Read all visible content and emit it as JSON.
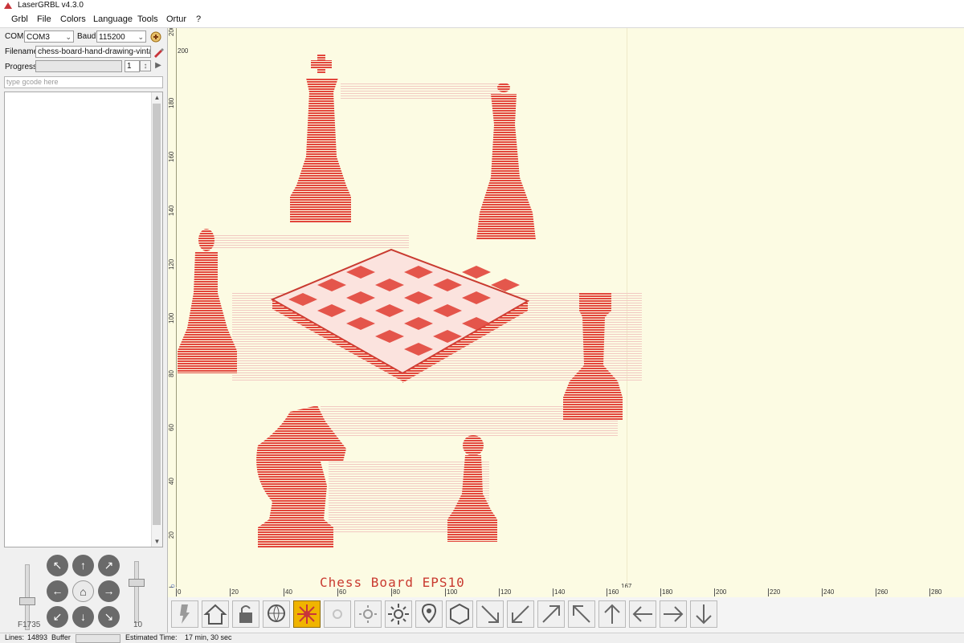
{
  "app": {
    "title": "LaserGRBL v4.3.0"
  },
  "menu": [
    "Grbl",
    "File",
    "Colors",
    "Language",
    "Tools",
    "Ortur",
    "?"
  ],
  "connection": {
    "com_label": "COM",
    "com_value": "COM3",
    "baud_label": "Baud",
    "baud_value": "115200",
    "filename_label": "Filename",
    "filename_value": "chess-board-hand-drawing-vintage-sty",
    "progress_label": "Progress",
    "progress_passes": "1"
  },
  "gcode": {
    "placeholder": "type gcode here"
  },
  "jog": {
    "feed_label": "F1735",
    "step_label": "10",
    "buttons": [
      "up-left",
      "up",
      "up-right",
      "left",
      "home",
      "right",
      "down-left",
      "down",
      "down-right"
    ]
  },
  "canvas": {
    "caption": "Chess Board EPS10",
    "cursor_readout": "167",
    "y_ticks": [
      "200",
      "180",
      "160",
      "140",
      "120",
      "100",
      "80",
      "60",
      "40",
      "20",
      "0"
    ],
    "x_ticks": [
      "0",
      "20",
      "40",
      "60",
      "80",
      "100",
      "120",
      "140",
      "160",
      "180",
      "200",
      "220",
      "240",
      "260",
      "280"
    ],
    "engraving_color": "#e2463c"
  },
  "status": {
    "lines_label": "Lines:",
    "lines_value": "14893",
    "buffer_label": "Buffer",
    "time_label": "Estimated Time:",
    "time_value": "17 min, 30 sec"
  },
  "toolbar": [
    "connect",
    "home",
    "unlock",
    "globe",
    "laser-on",
    "sun-low",
    "sun-mid",
    "sun-high",
    "map-pin",
    "polygon",
    "arrow-down-right",
    "arrow-down-left",
    "arrow-up-right",
    "arrow-up-left",
    "arrow-up",
    "arrow-left",
    "arrow-right",
    "arrow-down"
  ]
}
